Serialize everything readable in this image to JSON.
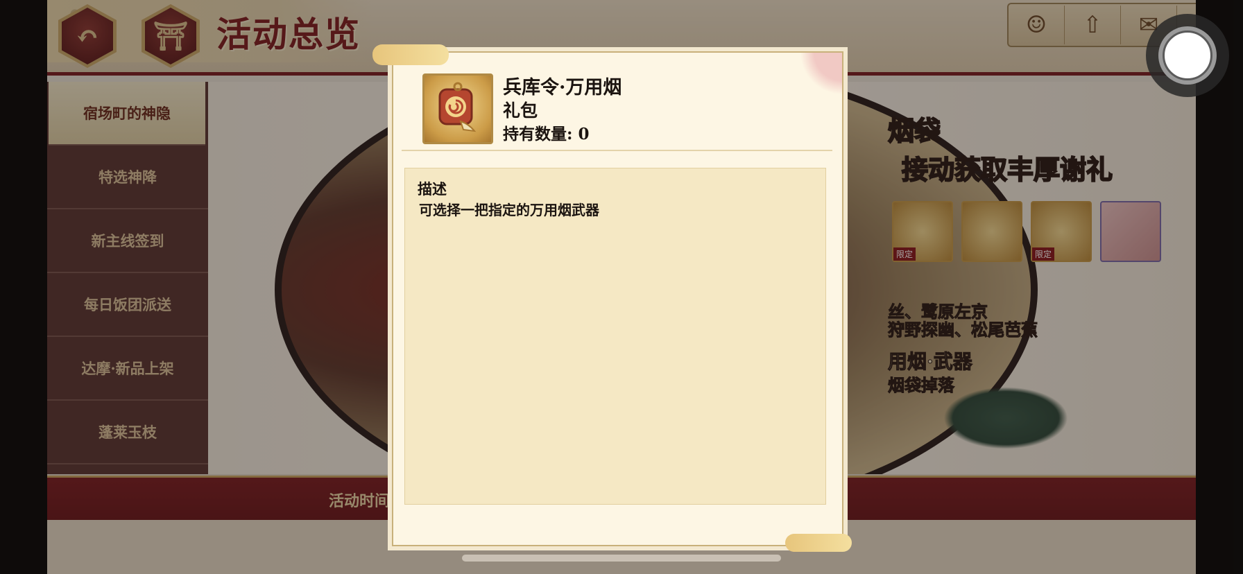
{
  "header": {
    "back_icon": "back-arrow-icon",
    "home_icon": "gate-icon",
    "title": "活动总览",
    "right_icons": [
      "character-icon",
      "upgrade-arrow-icon",
      "mail-icon"
    ]
  },
  "sidebar": {
    "items": [
      {
        "label": "宿场町的神隐",
        "active": true
      },
      {
        "label": "特选神降"
      },
      {
        "label": "新主线签到"
      },
      {
        "label": "每日饭团派送"
      },
      {
        "label": "达摩·新品上架"
      },
      {
        "label": "蓬莱玉枝"
      }
    ],
    "more_icon": "chevron-down-icon"
  },
  "banner": {
    "text_1": "烟袋",
    "text_2": "接动获取丰厚谢礼",
    "reward_limited_tag": "限定",
    "line_1": "丝、鹭原左京",
    "line_2": "狩野探幽、松尾芭蕉",
    "line_3": "用烟·武器",
    "line_4": "烟袋掉落"
  },
  "bottom_bar": {
    "event_time_label": "活动时间"
  },
  "modal": {
    "item_icon": "tobacco-pouch-icon",
    "item_name": "兵库令·万用烟",
    "item_type": "礼包",
    "count_label": "持有数量: 0",
    "desc_heading": "描述",
    "desc_text": "可选择一把指定的万用烟武器"
  },
  "colors": {
    "crimson": "#7b1f24",
    "gold": "#c9a45f",
    "parchment": "#f5e8c4",
    "sidebar": "#5b3834"
  }
}
